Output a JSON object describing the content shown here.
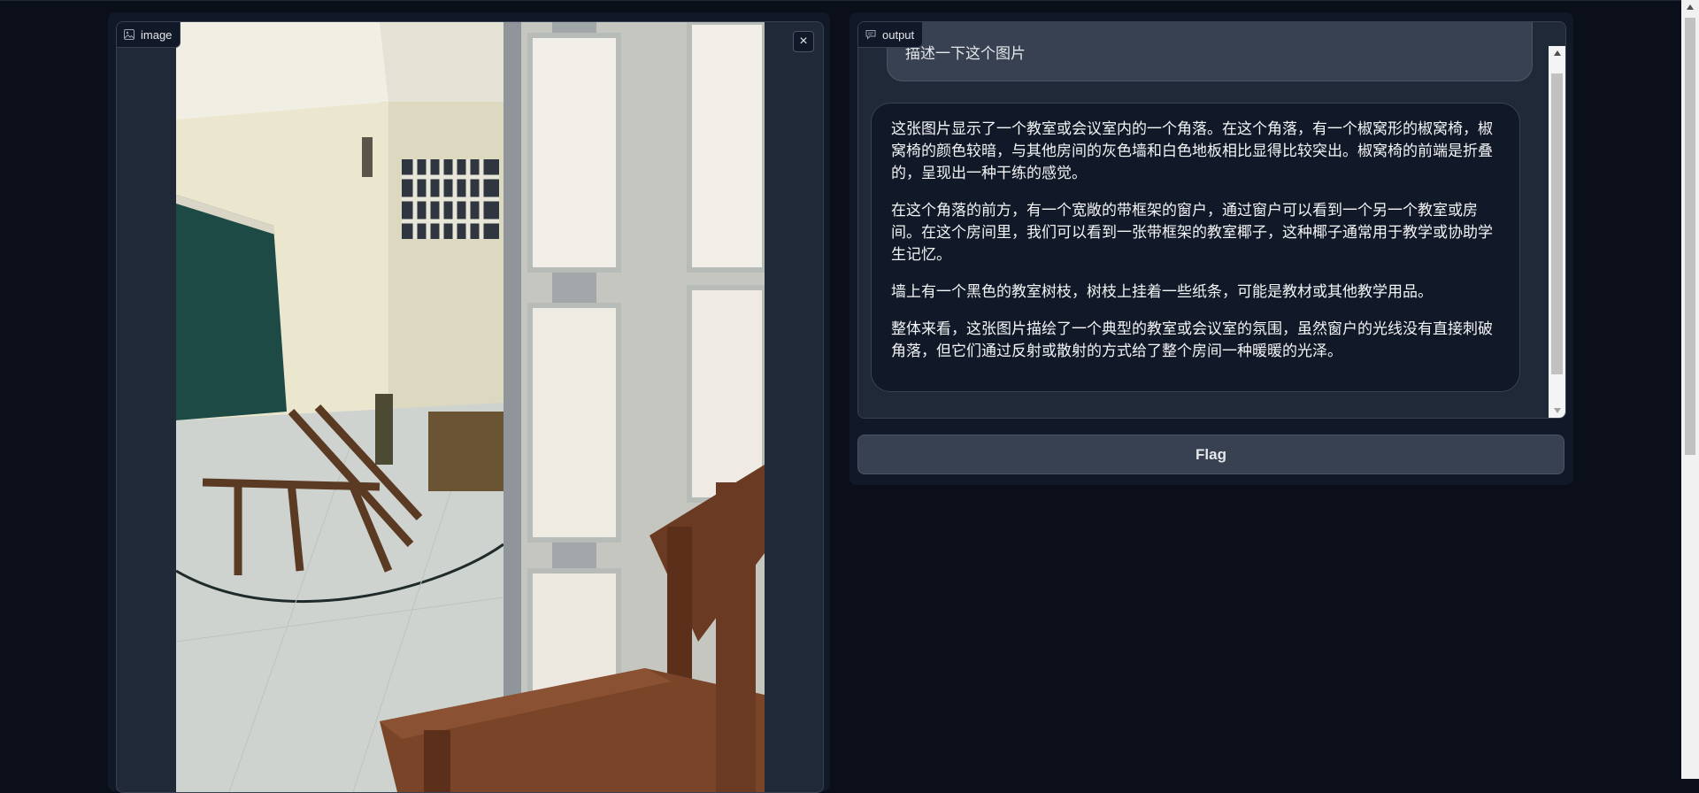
{
  "image_panel": {
    "label": "image",
    "close_symbol": "×",
    "icons": {
      "label_icon": "image-icon",
      "close_icon": "close-icon"
    }
  },
  "output_panel": {
    "label": "output",
    "icons": {
      "label_icon": "chat-icon"
    },
    "user_message": "描述一下这个图片",
    "bot_paragraphs": [
      "这张图片显示了一个教室或会议室内的一个角落。在这个角落，有一个椒窝形的椒窝椅，椒窝椅的颜色较暗，与其他房间的灰色墙和白色地板相比显得比较突出。椒窝椅的前端是折叠的，呈现出一种干练的感觉。",
      "在这个角落的前方，有一个宽敞的带框架的窗户，通过窗户可以看到一个另一个教室或房间。在这个房间里，我们可以看到一张带框架的教室椰子，这种椰子通常用于教学或协助学生记忆。",
      "墙上有一个黑色的教室树枝，树枝上挂着一些纸条，可能是教材或其他教学用品。",
      "整体来看，这张图片描绘了一个典型的教室或会议室的氛围，虽然窗户的光线没有直接刺破角落，但它们通过反射或散射的方式给了整个房间一种暖暖的光泽。"
    ]
  },
  "flag_button": {
    "label": "Flag"
  },
  "colors": {
    "background": "#0b0f19",
    "panel": "#111827",
    "block": "#1f2937",
    "border": "#374151",
    "button": "#374151"
  }
}
